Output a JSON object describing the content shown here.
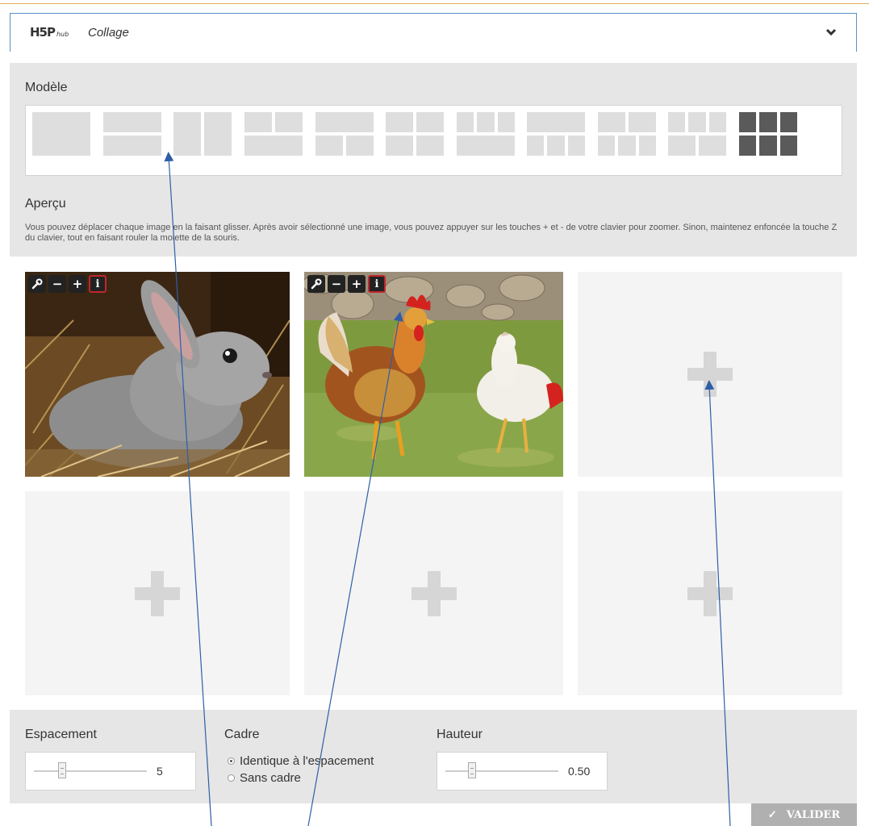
{
  "header": {
    "logo_text": "H5P",
    "logo_sub": "hub",
    "title": "Collage"
  },
  "models": {
    "label": "Modèle",
    "count": 11,
    "active_index": 10
  },
  "preview": {
    "label": "Aperçu",
    "description": "Vous pouvez déplacer chaque image en la faisant glisser. Après avoir sélectionné une image, vous pouvez appuyer sur les touches + et - de votre clavier pour zoomer. Sinon, maintenez enfoncée la touche Z du clavier, tout en faisant rouler la molette de la souris.",
    "tool_icons": [
      "wrench-icon",
      "minus-icon",
      "plus-icon",
      "info-icon"
    ],
    "tool_glyphs": {
      "minus": "−",
      "plus": "+",
      "info": "i"
    },
    "images": [
      "rabbit-image",
      "rooster-hen-image"
    ]
  },
  "controls": {
    "spacing": {
      "label": "Espacement",
      "value": "5",
      "level": 0.25
    },
    "frame": {
      "label": "Cadre",
      "options": [
        "Identique à l'espacement",
        "Sans cadre"
      ],
      "selected": 0
    },
    "height": {
      "label": "Hauteur",
      "value": "0.50",
      "level": 0.23
    }
  },
  "submit": {
    "label": "VALIDER",
    "check": "✓"
  },
  "colors": {
    "accent": "#5b8fc7",
    "active_model": "#5a5a5a",
    "info_border": "#c0272d",
    "annotation": "#2e5ea8"
  }
}
